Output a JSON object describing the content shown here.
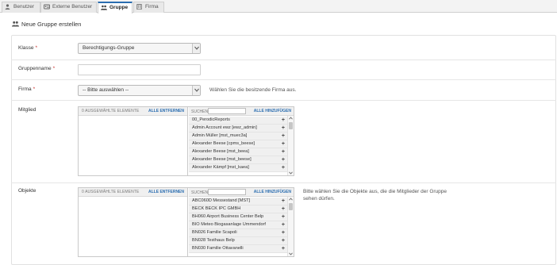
{
  "tabs": [
    {
      "label": "Benutzer",
      "icon": "user-icon"
    },
    {
      "label": "Externe Benutzer",
      "icon": "id-card-icon"
    },
    {
      "label": "Gruppe",
      "icon": "users-icon",
      "active": true
    },
    {
      "label": "Firma",
      "icon": "building-icon"
    }
  ],
  "page": {
    "title": "Neue Gruppe erstellen"
  },
  "form": {
    "klasse": {
      "label": "Klasse",
      "value": "Berechtigungs-Gruppe"
    },
    "gruppenname": {
      "label": "Gruppenname",
      "value": ""
    },
    "firma": {
      "label": "Firma",
      "value": "-- Bitte auswählen --",
      "help": "Wählen Sie die besitzende Firma aus."
    },
    "mitglied": {
      "label": "Mitglied",
      "selected_count": "0 AUSGEWÄHLTE ELEMENTE",
      "remove_all": "ALLE ENTFERNEN",
      "search_label": "SUCHEN:",
      "add_all": "ALLE HINZUFÜGEN",
      "items": [
        "00_PerodicReports",
        "Admin Account ewz [ewz_admin]",
        "Admin Müller [mst_muec3a]",
        "Alexander Beese [cpms_beese]",
        "Alexander Beese [mst_beea]",
        "Alexander Beese [mst_beese]",
        "Alexander Kämpf [mst_kaea]"
      ]
    },
    "objekte": {
      "label": "Objekte",
      "selected_count": "0 AUSGEWÄHLTE ELEMENTE",
      "remove_all": "ALLE ENTFERNEN",
      "search_label": "SUCHEN:",
      "add_all": "ALLE HINZUFÜGEN",
      "help": "Bitte wählen Sie die Objekte aus, die die Mitglieder der Gruppe sehen dürfen.",
      "items": [
        "ABC060D Messestand [MST]",
        "BECK BECK IPC GMBH",
        "BH060 Airport Business Center Belp",
        "BIO Meteo Biogasanlage Ummendorf",
        "BN026 Familie Scapoli",
        "BN028 Testhaus Belp",
        "BN030 Familie Ottavanelli"
      ]
    }
  },
  "colors": {
    "accent": "#2a6db0",
    "required": "#c9302c"
  }
}
